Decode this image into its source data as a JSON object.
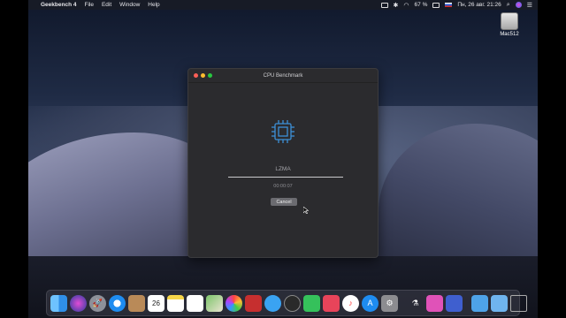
{
  "menubar": {
    "app_name": "Geekbench 4",
    "menus": [
      "File",
      "Edit",
      "Window",
      "Help"
    ],
    "battery": "67 %",
    "datetime": "Пн, 26 авг.  21:26"
  },
  "desktop": {
    "drive_label": "Mac512"
  },
  "window": {
    "title": "CPU Benchmark",
    "task": "LZMA",
    "progress": 1.0,
    "elapsed": "00:00:07",
    "cancel_label": "Cancel"
  },
  "dock": {
    "calendar_day": "26",
    "items": [
      "finder-icon",
      "siri-icon",
      "launchpad-icon",
      "safari-icon",
      "contacts-icon",
      "calendar-icon",
      "notes-icon",
      "reminders-icon",
      "maps-icon",
      "photos-icon",
      "geekbench-icon",
      "messages-icon",
      "facetime-icon",
      "music-icon",
      "appstore-icon",
      "settings-icon",
      "scripts-icon",
      "screenshot-icon",
      "news-icon",
      "trash-icon"
    ]
  },
  "colors": {
    "accent_blue": "#3c8fd6",
    "window_bg": "#2b2b2e"
  }
}
